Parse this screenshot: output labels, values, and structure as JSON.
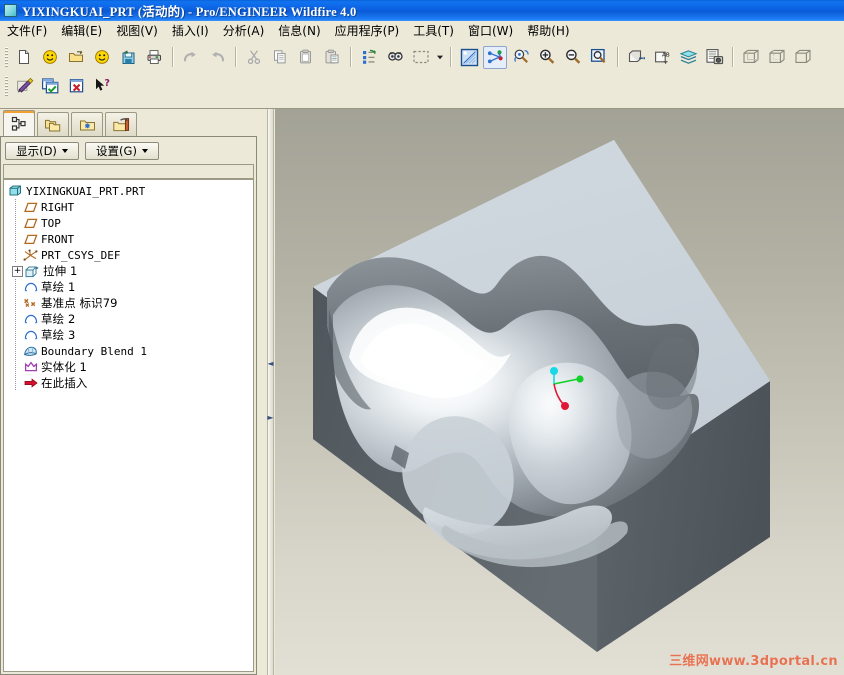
{
  "window": {
    "title": "YIXINGKUAI_PRT (活动的) - Pro/ENGINEER Wildfire 4.0",
    "icon": "part-window-icon"
  },
  "menubar": {
    "items": [
      {
        "label": "文件(F)",
        "name": "menu-file"
      },
      {
        "label": "编辑(E)",
        "name": "menu-edit"
      },
      {
        "label": "视图(V)",
        "name": "menu-view"
      },
      {
        "label": "插入(I)",
        "name": "menu-insert"
      },
      {
        "label": "分析(A)",
        "name": "menu-analysis"
      },
      {
        "label": "信息(N)",
        "name": "menu-info"
      },
      {
        "label": "应用程序(P)",
        "name": "menu-applications"
      },
      {
        "label": "工具(T)",
        "name": "menu-tools"
      },
      {
        "label": "窗口(W)",
        "name": "menu-window"
      },
      {
        "label": "帮助(H)",
        "name": "menu-help"
      }
    ]
  },
  "toolbar": {
    "row1": [
      {
        "icon": "new-file-icon"
      },
      {
        "icon": "open-recent-icon"
      },
      {
        "icon": "open-folder-icon"
      },
      {
        "icon": "set-working-dir-icon"
      },
      {
        "icon": "save-icon"
      },
      {
        "icon": "print-icon"
      },
      {
        "icon": "undo-icon"
      },
      {
        "icon": "redo-icon"
      },
      {
        "icon": "cut-icon"
      },
      {
        "icon": "copy-icon"
      },
      {
        "icon": "paste-icon"
      },
      {
        "icon": "paste-special-icon"
      },
      {
        "icon": "regenerate-icon"
      },
      {
        "icon": "find-icon"
      },
      {
        "icon": "select-box-icon"
      },
      {
        "icon": "repaint-icon"
      },
      {
        "icon": "spin-center-icon"
      },
      {
        "icon": "reorient-icon"
      },
      {
        "icon": "zoom-in-icon"
      },
      {
        "icon": "zoom-out-icon"
      },
      {
        "icon": "refit-icon"
      },
      {
        "icon": "datum-planes-icon"
      },
      {
        "icon": "datum-tags-icon"
      },
      {
        "icon": "layers-icon"
      },
      {
        "icon": "saved-views-icon"
      },
      {
        "icon": "wireframe-icon"
      },
      {
        "icon": "hidden-line-icon"
      },
      {
        "icon": "shading-icon"
      }
    ],
    "row2": [
      {
        "icon": "edit-definition-icon"
      },
      {
        "icon": "accept-icon"
      },
      {
        "icon": "cancel-icon"
      },
      {
        "icon": "context-help-icon"
      }
    ]
  },
  "left_panel": {
    "tabs": [
      {
        "name": "tab-model-tree",
        "icon": "model-tree-icon",
        "selected": true
      },
      {
        "name": "tab-folder-browser",
        "icon": "folder-browser-icon",
        "selected": false
      },
      {
        "name": "tab-favorites",
        "icon": "favorites-folder-icon",
        "selected": false
      },
      {
        "name": "tab-connections",
        "icon": "tools-folder-icon",
        "selected": false
      }
    ],
    "show_button": "显示(D)",
    "settings_button": "设置(G)",
    "tree": [
      {
        "label": "YIXINGKUAI_PRT.PRT",
        "depth": 0,
        "icon": "part-icon",
        "expander": "",
        "mono": true
      },
      {
        "label": "RIGHT",
        "depth": 1,
        "icon": "datum-plane-icon",
        "expander": "",
        "mono": true
      },
      {
        "label": "TOP",
        "depth": 1,
        "icon": "datum-plane-icon",
        "expander": "",
        "mono": true
      },
      {
        "label": "FRONT",
        "depth": 1,
        "icon": "datum-plane-icon",
        "expander": "",
        "mono": true
      },
      {
        "label": "PRT_CSYS_DEF",
        "depth": 1,
        "icon": "csys-icon",
        "expander": "",
        "mono": true
      },
      {
        "label": "拉伸 1",
        "depth": 1,
        "icon": "extrude-icon",
        "expander": "+",
        "mono": false
      },
      {
        "label": "草绘 1",
        "depth": 1,
        "icon": "sketch-icon",
        "expander": "",
        "mono": false
      },
      {
        "label": "基准点 标识79",
        "depth": 1,
        "icon": "datum-point-icon",
        "expander": "",
        "mono": false
      },
      {
        "label": "草绘 2",
        "depth": 1,
        "icon": "sketch-icon",
        "expander": "",
        "mono": false
      },
      {
        "label": "草绘 3",
        "depth": 1,
        "icon": "sketch-icon",
        "expander": "",
        "mono": false
      },
      {
        "label": "Boundary Blend 1",
        "depth": 1,
        "icon": "boundary-blend-icon",
        "expander": "",
        "mono": true
      },
      {
        "label": "实体化 1",
        "depth": 1,
        "icon": "solidify-icon",
        "expander": "",
        "mono": false
      },
      {
        "label": "在此插入",
        "depth": 1,
        "icon": "insert-here-icon",
        "expander": "",
        "mono": false
      }
    ]
  },
  "splitter": {
    "collapse_left": "◄",
    "collapse_right": "►"
  },
  "viewport": {
    "watermark": "三维网www.3dportal.cn",
    "csys": {
      "x_axis_color": "#e01838",
      "y_axis_color": "#12d128",
      "z_axis_color": "#18d8e8"
    },
    "model": {
      "top_face_color": "#ccd5dc",
      "side_face_color": "#5d656b",
      "cavity_highlight": "#ffffff",
      "cavity_shadow": "#6f777d"
    },
    "background": {
      "top": "#a3a296",
      "bottom": "#e2e0d5"
    }
  }
}
